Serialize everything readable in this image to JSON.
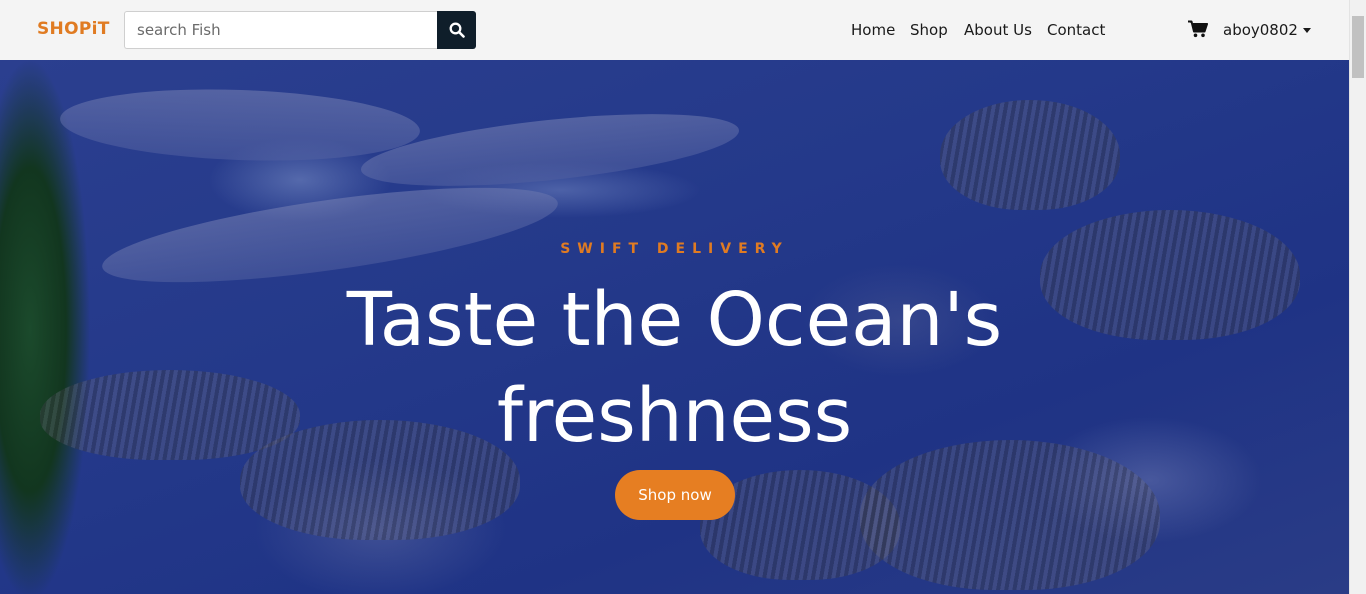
{
  "navbar": {
    "brand": "SHOPiT",
    "search_placeholder": "search Fish",
    "links": [
      "Home",
      "Shop",
      "About Us",
      "Contact"
    ],
    "username": "aboy0802"
  },
  "hero": {
    "tagline": "SWIFT DELIVERY",
    "headline_line1": "Taste the Ocean's",
    "headline_line2": "freshness",
    "cta_label": "Shop now"
  },
  "colors": {
    "accent": "#e67e22",
    "search_button": "#0f1e2a",
    "hero_overlay": "#24398a"
  },
  "icons": [
    "search-icon",
    "cart-icon",
    "caret-down-icon"
  ]
}
